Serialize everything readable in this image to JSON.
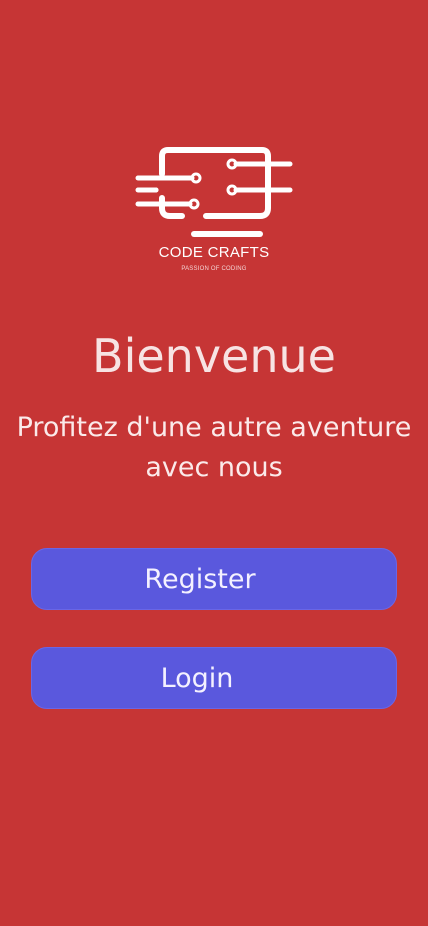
{
  "logo": {
    "title": "CODE CRAFTS",
    "tagline": "PASSION OF CODING"
  },
  "welcome": {
    "title": "Bienvenue",
    "subtitle": "Profitez d'une autre aventure avec nous"
  },
  "actions": {
    "register_label": "Register",
    "login_label": "Login"
  },
  "colors": {
    "background": "#c63535",
    "button": "#5a58dd",
    "text": "#ffffff"
  }
}
